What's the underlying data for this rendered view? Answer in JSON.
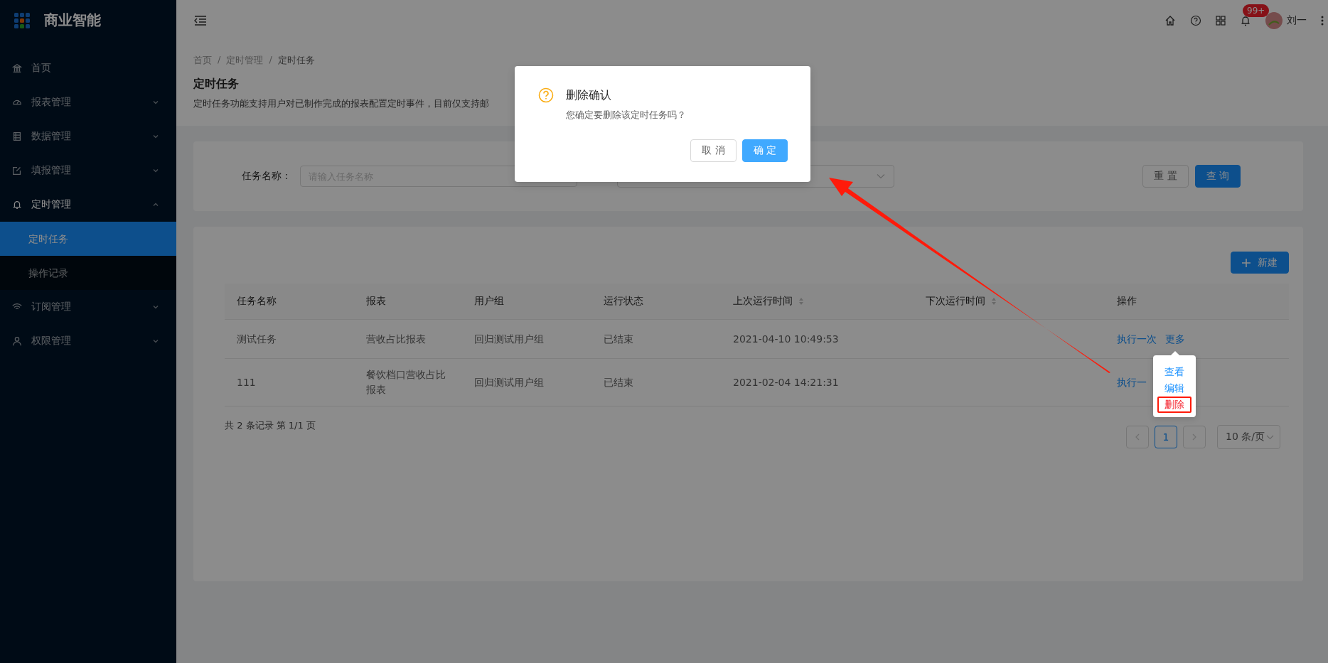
{
  "app": {
    "logo_text": "商业智能"
  },
  "sidebar": {
    "items": [
      {
        "label": "首页"
      },
      {
        "label": "报表管理",
        "expanded": false
      },
      {
        "label": "数据管理",
        "expanded": false
      },
      {
        "label": "填报管理",
        "expanded": false
      },
      {
        "label": "定时管理",
        "expanded": true,
        "children": [
          {
            "label": "定时任务",
            "selected": true
          },
          {
            "label": "操作记录",
            "selected": false
          }
        ]
      },
      {
        "label": "订阅管理",
        "expanded": false
      },
      {
        "label": "权限管理",
        "expanded": false
      }
    ]
  },
  "header": {
    "notification_badge": "99+",
    "user_name": "刘一"
  },
  "breadcrumb": {
    "separator": "/",
    "items": [
      "首页",
      "定时管理",
      "定时任务"
    ]
  },
  "page": {
    "title": "定时任务",
    "description": "定时任务功能支持用户对已制作完成的报表配置定时事件，目前仅支持邮"
  },
  "search": {
    "fields": [
      {
        "kind": "input",
        "label": "任务名称：",
        "placeholder": "请输入任务名称"
      },
      {
        "kind": "select"
      }
    ],
    "buttons": [
      {
        "label": "重 置",
        "kind": "default"
      },
      {
        "label": "查 询",
        "kind": "primary"
      }
    ]
  },
  "table": {
    "new_button": "新建",
    "columns": [
      {
        "label": "任务名称",
        "sortable": false
      },
      {
        "label": "报表",
        "sortable": false
      },
      {
        "label": "用户组",
        "sortable": false
      },
      {
        "label": "运行状态",
        "sortable": false
      },
      {
        "label": "上次运行时间",
        "sortable": true
      },
      {
        "label": "下次运行时间",
        "sortable": true
      },
      {
        "label": "操作",
        "sortable": false
      }
    ],
    "rows": [
      {
        "cells": [
          "测试任务",
          "营收占比报表",
          "回归测试用户组",
          "已结束",
          "2021-04-10 10:49:53",
          ""
        ],
        "actions": [
          "执行一次",
          "更多"
        ],
        "menu_open": true
      },
      {
        "cells": [
          "111",
          "餐饮档口营收占比报表",
          "回归测试用户组",
          "已结束",
          "2021-02-04 14:21:31",
          ""
        ],
        "actions": [
          "执行一"
        ],
        "menu_open": false
      }
    ]
  },
  "pagination": {
    "summary": "共 2 条记录 第 1/1 页",
    "pages": [
      {
        "label": "1",
        "selected": true
      }
    ],
    "page_size": "10 条/页"
  },
  "dropdown_menu": {
    "items": [
      {
        "label": "查看",
        "kind": "normal",
        "highlighted": false
      },
      {
        "label": "编辑",
        "kind": "normal",
        "highlighted": false
      },
      {
        "label": "删除",
        "kind": "danger",
        "highlighted": true
      }
    ]
  },
  "dialog": {
    "title": "删除确认",
    "message": "您确定要删除该定时任务吗？",
    "buttons": [
      {
        "label": "取 消",
        "kind": "default"
      },
      {
        "label": "确 定",
        "kind": "primary"
      }
    ]
  }
}
